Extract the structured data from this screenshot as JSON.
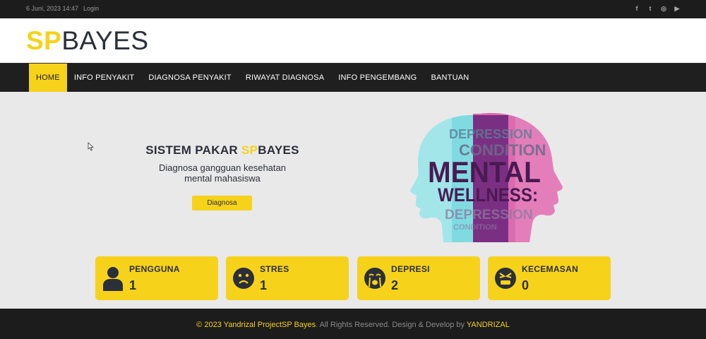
{
  "topbar": {
    "date": "6 Juni, 2023 14:47",
    "login": "Login",
    "social": [
      {
        "name": "facebook-icon",
        "glyph": "f"
      },
      {
        "name": "twitter-icon",
        "glyph": "t"
      },
      {
        "name": "instagram-icon",
        "glyph": "◎"
      },
      {
        "name": "youtube-icon",
        "glyph": "▶"
      }
    ]
  },
  "brand": {
    "sp": "SP",
    "bayes": "BAYES"
  },
  "nav": {
    "items": [
      {
        "label": "HOME",
        "active": true
      },
      {
        "label": "INFO PENYAKIT",
        "active": false
      },
      {
        "label": "DIAGNOSA PENYAKIT",
        "active": false
      },
      {
        "label": "RIWAYAT DIAGNOSA",
        "active": false
      },
      {
        "label": "INFO PENGEMBANG",
        "active": false
      },
      {
        "label": "BANTUAN",
        "active": false
      }
    ]
  },
  "hero": {
    "title_prefix": "SISTEM PAKAR ",
    "title_sp": "SP",
    "title_suffix": "BAYES",
    "subtitle_line1": "Diagnosa gangguan kesehatan",
    "subtitle_line2": "mental mahasiswa",
    "button": "Diagnosa",
    "image_text": {
      "depression_top": "DEPRESSION",
      "condition": "CONDITION",
      "mental": "MENTAL",
      "wellness": "WELLNESS:",
      "depression_bottom": "DEPRESSION",
      "condition_bottom": "CONDITION"
    }
  },
  "stats": [
    {
      "label": "PENGGUNA",
      "value": "1",
      "icon": "user-icon"
    },
    {
      "label": "STRES",
      "value": "1",
      "icon": "sad-face-icon"
    },
    {
      "label": "DEPRESI",
      "value": "2",
      "icon": "crying-face-icon"
    },
    {
      "label": "KECEMASAN",
      "value": "0",
      "icon": "angry-face-icon"
    }
  ],
  "footer": {
    "copyright_prefix": "© ",
    "project": "2023 Yandrizal ProjectSP Bayes",
    "middle": ". All Rights Reserved. Design & Develop by ",
    "author": "YANDRIZAL"
  },
  "colors": {
    "accent": "#f6d21b",
    "dark": "#1f1f1f",
    "text": "#2b2f3a"
  }
}
